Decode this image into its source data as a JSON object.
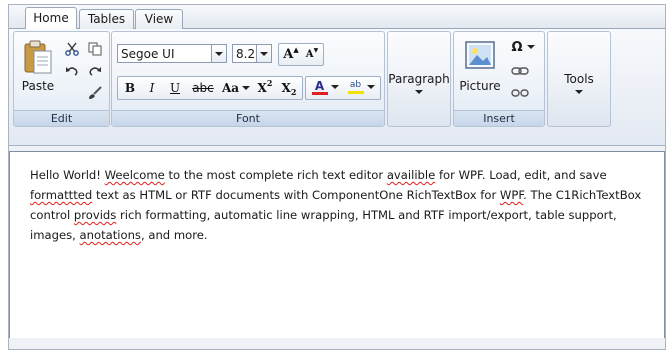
{
  "tabs": [
    "Home",
    "Tables",
    "View"
  ],
  "active_tab": "Home",
  "groups": {
    "edit": {
      "label": "Edit",
      "paste_label": "Paste"
    },
    "font": {
      "label": "Font",
      "font_family": "Segoe UI",
      "font_size": "8.25",
      "bold": "B",
      "italic": "I",
      "underline": "U",
      "strikethrough": "abc",
      "change_case": "Aa",
      "superscript_base": "X",
      "superscript_mark": "2",
      "subscript_base": "X",
      "subscript_mark": "2",
      "grow_font": "A",
      "shrink_font": "A",
      "font_color_glyph": "A",
      "highlight_glyph": "ab",
      "font_color": "#e02020",
      "highlight_color": "#f4e300"
    },
    "paragraph": {
      "label": "Paragraph"
    },
    "insert": {
      "label": "Insert",
      "picture_label": "Picture",
      "symbol_glyph": "Ω"
    },
    "tools": {
      "label": "Tools"
    }
  },
  "document": {
    "segments": [
      {
        "text": "Hello World! ",
        "misspelled": false
      },
      {
        "text": "Weelcome",
        "misspelled": true
      },
      {
        "text": " to the most complete rich text editor ",
        "misspelled": false
      },
      {
        "text": "availible",
        "misspelled": true
      },
      {
        "text": " for WPF. Load, edit, and save ",
        "misspelled": false
      },
      {
        "text": "formattted",
        "misspelled": true
      },
      {
        "text": " text as HTML or RTF documents with ComponentOne RichTextBox for ",
        "misspelled": false
      },
      {
        "text": "WPF",
        "misspelled": true
      },
      {
        "text": ". The C1RichTextBox control ",
        "misspelled": false
      },
      {
        "text": "provids",
        "misspelled": true
      },
      {
        "text": " rich formatting, automatic line wrapping, HTML and RTF import/export, table support, images, ",
        "misspelled": false
      },
      {
        "text": "anotations",
        "misspelled": true
      },
      {
        "text": ", and more.",
        "misspelled": false
      }
    ]
  }
}
